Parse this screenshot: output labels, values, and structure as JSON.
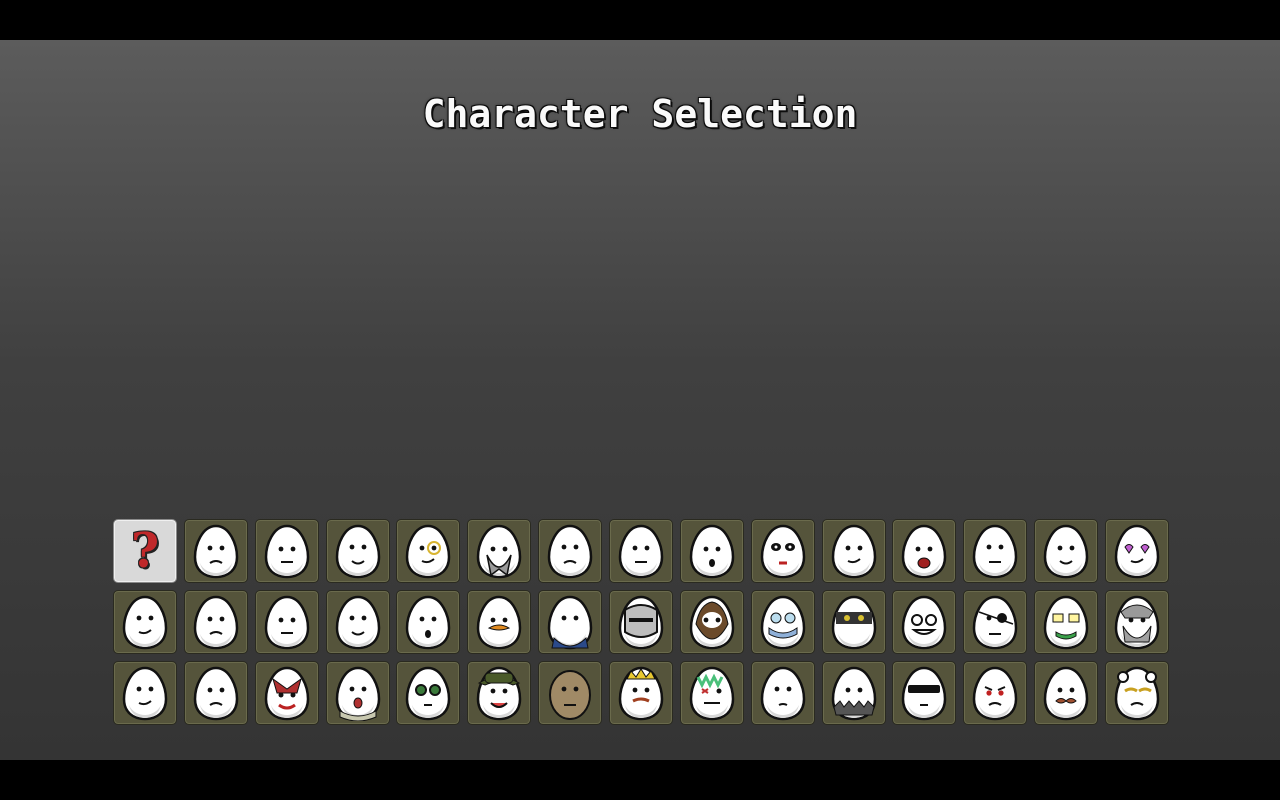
{
  "screen": {
    "title": "Character Selection",
    "colors": {
      "tile_background": "#55543b",
      "selected_tile": "#d9d9d9",
      "random_mark": "#c0282a",
      "egg_fill": "#ffffff"
    }
  },
  "characters": [
    {
      "id": "random",
      "icon": "question-mark-icon",
      "label": "?",
      "selected": true
    },
    {
      "id": "c01",
      "icon": "egg-face-icon",
      "variant": "smirk"
    },
    {
      "id": "c02",
      "icon": "egg-face-icon",
      "variant": "bruised-eye"
    },
    {
      "id": "c03",
      "icon": "egg-face-icon",
      "variant": "tired"
    },
    {
      "id": "c04",
      "icon": "egg-face-icon",
      "variant": "monocle"
    },
    {
      "id": "c05",
      "icon": "egg-face-icon",
      "variant": "grey-wizard"
    },
    {
      "id": "c06",
      "icon": "egg-face-icon",
      "variant": "derp"
    },
    {
      "id": "c07",
      "icon": "egg-face-icon",
      "variant": "old-man"
    },
    {
      "id": "c08",
      "icon": "egg-face-icon",
      "variant": "surprised"
    },
    {
      "id": "c09",
      "icon": "egg-face-icon",
      "variant": "panda"
    },
    {
      "id": "c10",
      "icon": "egg-face-icon",
      "variant": "bearded"
    },
    {
      "id": "c11",
      "icon": "egg-face-icon",
      "variant": "shouting"
    },
    {
      "id": "c12",
      "icon": "egg-face-icon",
      "variant": "happy"
    },
    {
      "id": "c13",
      "icon": "egg-face-icon",
      "variant": "frown"
    },
    {
      "id": "c14",
      "icon": "egg-face-icon",
      "variant": "heart-glasses"
    },
    {
      "id": "c15",
      "icon": "egg-face-icon",
      "variant": "crazy-eyes"
    },
    {
      "id": "c16",
      "icon": "egg-face-icon",
      "variant": "whistle"
    },
    {
      "id": "c17",
      "icon": "egg-face-icon",
      "variant": "smoker"
    },
    {
      "id": "c18",
      "icon": "egg-face-icon",
      "variant": "goatee"
    },
    {
      "id": "c19",
      "icon": "egg-face-icon",
      "variant": "startled"
    },
    {
      "id": "c20",
      "icon": "egg-face-icon",
      "variant": "orange-stache"
    },
    {
      "id": "c21",
      "icon": "egg-face-icon",
      "variant": "suit"
    },
    {
      "id": "c22",
      "icon": "egg-face-icon",
      "variant": "knight-helmet"
    },
    {
      "id": "c23",
      "icon": "egg-face-icon",
      "variant": "wild-beard"
    },
    {
      "id": "c24",
      "icon": "egg-face-icon",
      "variant": "masked-glasses"
    },
    {
      "id": "c25",
      "icon": "egg-face-icon",
      "variant": "ninja"
    },
    {
      "id": "c26",
      "icon": "egg-face-icon",
      "variant": "toothy-glasses"
    },
    {
      "id": "c27",
      "icon": "egg-face-icon",
      "variant": "eyepatch"
    },
    {
      "id": "c28",
      "icon": "egg-face-icon",
      "variant": "nerd-green"
    },
    {
      "id": "c29",
      "icon": "egg-face-icon",
      "variant": "viking"
    },
    {
      "id": "c30",
      "icon": "egg-face-icon",
      "variant": "drool"
    },
    {
      "id": "c31",
      "icon": "egg-face-icon",
      "variant": "worried"
    },
    {
      "id": "c32",
      "icon": "egg-face-icon",
      "variant": "demon"
    },
    {
      "id": "c33",
      "icon": "egg-face-icon",
      "variant": "scarf"
    },
    {
      "id": "c34",
      "icon": "egg-face-icon",
      "variant": "goggles"
    },
    {
      "id": "c35",
      "icon": "egg-face-icon",
      "variant": "green-hat"
    },
    {
      "id": "c36",
      "icon": "egg-face-icon",
      "variant": "potato"
    },
    {
      "id": "c37",
      "icon": "egg-face-icon",
      "variant": "crown"
    },
    {
      "id": "c38",
      "icon": "egg-face-icon",
      "variant": "zombie"
    },
    {
      "id": "c39",
      "icon": "egg-face-icon",
      "variant": "blank"
    },
    {
      "id": "c40",
      "icon": "egg-face-icon",
      "variant": "spiked-collar"
    },
    {
      "id": "c41",
      "icon": "egg-face-icon",
      "variant": "shades"
    },
    {
      "id": "c42",
      "icon": "egg-face-icon",
      "variant": "angry-red"
    },
    {
      "id": "c43",
      "icon": "egg-face-icon",
      "variant": "mustache"
    },
    {
      "id": "c44",
      "icon": "egg-face-icon",
      "variant": "bear-ears"
    }
  ]
}
